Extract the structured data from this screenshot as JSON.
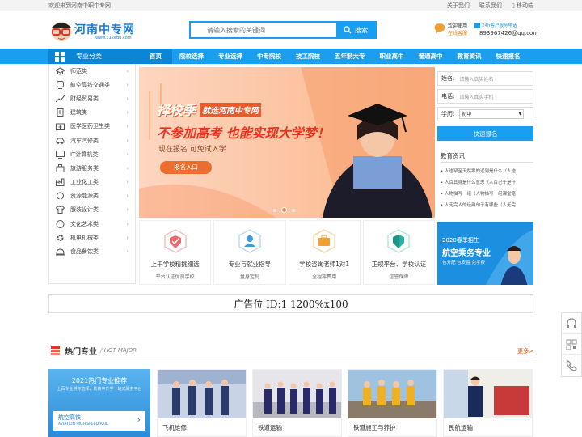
{
  "topbar": {
    "welcome": "欢迎来到河南中职中专网",
    "links": [
      "关于我们",
      "联系我们",
      "移动端"
    ]
  },
  "header": {
    "logo_text": "河南中专网",
    "logo_url": "www.112edu.com",
    "search_placeholder": "请输入搜索的关键词",
    "search_button": "搜索",
    "hotline_title": "欢迎使用",
    "hotline_sub": "在线客服",
    "hotline_label": "24h客户服务电话",
    "hotline_email": "893967426@qq.com"
  },
  "nav": {
    "category_label": "专业分类",
    "items": [
      "首页",
      "院校选择",
      "专业选择",
      "中专院校",
      "技工院校",
      "五年制大专",
      "职业高中",
      "普通高中",
      "教育资讯",
      "快速报名"
    ],
    "active_index": 0
  },
  "sidebar": {
    "items": [
      "师范类",
      "航空高铁交通类",
      "财经贸易类",
      "建筑类",
      "医学医药卫生类",
      "汽车汽修类",
      "IT计算机类",
      "旅游服务类",
      "工业化工类",
      "资源能源类",
      "服装设计类",
      "文化艺术类",
      "机电机械类",
      "食品餐饮类"
    ]
  },
  "banner": {
    "line1_a": "择校季",
    "line1_b": "就选河南中专网",
    "line2": "不参加高考 也能实现大学梦！",
    "line3": "现在报名 可免试入学",
    "button": "报名入口"
  },
  "form": {
    "name_label": "姓名:",
    "name_placeholder": "请输入真实姓名",
    "phone_label": "电话:",
    "phone_placeholder": "请输入真实手机",
    "edu_label": "学历:",
    "edu_value": "初中",
    "submit": "快速报名"
  },
  "news": {
    "title": "教育资讯",
    "items": [
      "人迹罕至天然零的近到是什么（人迹",
      "人百其身是什么意思（人百己千是什",
      "人物描写一组（人物描写一组课堂笔",
      "人无完人的经典句子有哪些（人无完"
    ]
  },
  "features": [
    {
      "title": "上千学校精挑细选",
      "sub": "平台认证优良学校",
      "color": "#e86a6a"
    },
    {
      "title": "专业与就业指导",
      "sub": "量身定制",
      "color": "#3a9be0"
    },
    {
      "title": "学校咨询老师1对1",
      "sub": "全程零费用",
      "color": "#f0a030"
    },
    {
      "title": "正规平台、学校认证",
      "sub": "信誉保障",
      "color": "#2ab0a0"
    }
  ],
  "sidead": {
    "line1": "2020春季招生",
    "line2": "航空乘务专业",
    "line3": "包分配 包安置 免学费"
  },
  "ad": {
    "text": "广告位 ID:1 1200%x100"
  },
  "hot": {
    "title": "热门专业",
    "en": "/ HOT MAJOR",
    "more": "更多>",
    "promo_title": "2021热门专业推荐",
    "promo_sub": "上百专业供你选择，助高中升学一站式服务平台",
    "promo_label": "航空高铁",
    "promo_en": "AVIATION HIGH SPEED RAIL",
    "cards": [
      "飞机维修",
      "铁道运输",
      "铁道施工与养护",
      "民航运输"
    ]
  }
}
